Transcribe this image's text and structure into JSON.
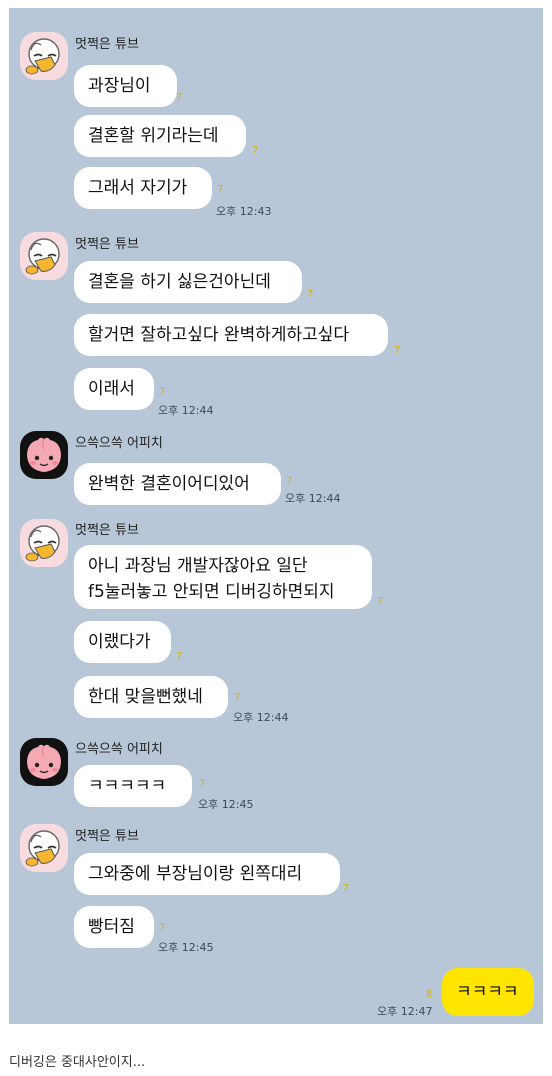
{
  "senders": {
    "tube": "멋쩍은 튜브",
    "apeach": "으쓱으쓱 어피치"
  },
  "groups": [
    {
      "sender": "멋쩍은 튜브",
      "messages": [
        {
          "text": "과장님이",
          "count": "7"
        },
        {
          "text": "결혼할 위기라는데",
          "count": "7"
        },
        {
          "text": "그래서 자기가",
          "count": "7",
          "time": "오후 12:43"
        }
      ]
    },
    {
      "sender": "멋쩍은 튜브",
      "messages": [
        {
          "text": "결혼을 하기 싫은건아닌데",
          "count": "7"
        },
        {
          "text": "할거면 잘하고싶다 완벽하게하고싶다",
          "count": "7"
        },
        {
          "text": "이래서",
          "count": "7",
          "time": "오후 12:44"
        }
      ]
    },
    {
      "sender": "으쓱으쓱 어피치",
      "messages": [
        {
          "text": "완벽한 결혼이어디있어",
          "count": "7",
          "time": "오후 12:44"
        }
      ]
    },
    {
      "sender": "멋쩍은 튜브",
      "messages": [
        {
          "line1": "아니 과장님 개발자잖아요 일단",
          "line2": "f5눌러놓고 안되면 디버깅하면되지",
          "count": "7"
        },
        {
          "text": "이랬다가",
          "count": "7"
        },
        {
          "text": "한대 맞을뻔했네",
          "count": "7",
          "time": "오후 12:44"
        }
      ]
    },
    {
      "sender": "으쓱으쓱 어피치",
      "messages": [
        {
          "text": "ㅋㅋㅋㅋㅋ",
          "count": "7",
          "time": "오후 12:45"
        }
      ]
    },
    {
      "sender": "멋쩍은 튜브",
      "messages": [
        {
          "text": "그와중에 부장님이랑 왼쪽대리",
          "count": "7"
        },
        {
          "text": "빵터짐",
          "count": "7",
          "time": "오후 12:45"
        }
      ]
    }
  ],
  "my_message": {
    "text": "ㅋㅋㅋㅋ",
    "count": "8",
    "time": "오후 12:47"
  },
  "caption": "디버깅은 중대사안이지...",
  "colors": {
    "chat_background": "#b7c7d7",
    "my_bubble": "#fee500",
    "other_bubble": "#ffffff",
    "unread_count": "#d4b21c"
  },
  "avatars": {
    "tube": "tube-character-icon",
    "apeach": "apeach-character-icon"
  }
}
